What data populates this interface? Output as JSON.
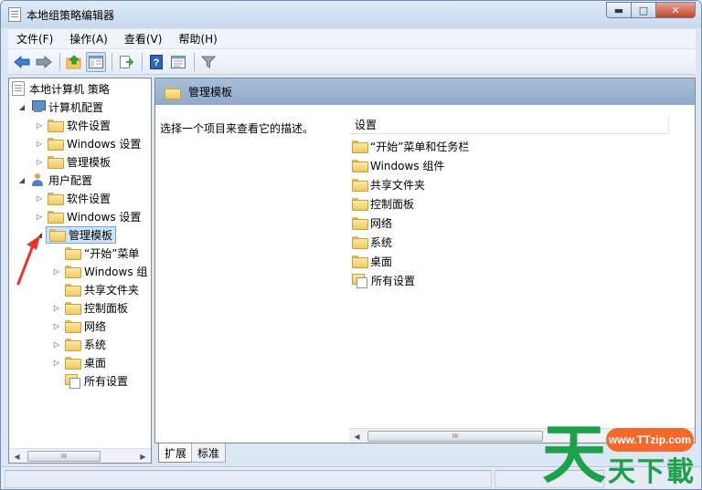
{
  "window": {
    "title": "本地组策略编辑器",
    "controls": {
      "minimize": "▬",
      "maximize": "□",
      "close": "✕"
    }
  },
  "menu": [
    {
      "label": "文件(F)"
    },
    {
      "label": "操作(A)"
    },
    {
      "label": "查看(V)"
    },
    {
      "label": "帮助(H)"
    }
  ],
  "toolbar": {
    "icons": [
      "back-arrow-icon",
      "forward-arrow-icon",
      "up-folder-icon",
      "show-hide-tree-icon",
      "export-list-icon",
      "help-icon",
      "properties-icon",
      "filter-icon"
    ],
    "help_glyph": "?"
  },
  "tree": {
    "root": "本地计算机 策略",
    "computer_config": {
      "label": "计算机配置",
      "children": [
        "软件设置",
        "Windows 设置",
        "管理模板"
      ]
    },
    "user_config": {
      "label": "用户配置",
      "children": [
        "软件设置",
        "Windows 设置"
      ],
      "selected": "管理模板",
      "selected_children": [
        "“开始”菜单",
        "Windows 组",
        "共享文件夹",
        "控制面板",
        "网络",
        "系统",
        "桌面",
        "所有设置"
      ]
    },
    "scroll_thumb": "III"
  },
  "details": {
    "header_title": "管理模板",
    "description": "选择一个项目来查看它的描述。",
    "column_header": "设置",
    "items": [
      "“开始”菜单和任务栏",
      "Windows 组件",
      "共享文件夹",
      "控制面板",
      "网络",
      "系统",
      "桌面",
      "所有设置"
    ],
    "scroll_thumb": "III"
  },
  "tabs": [
    {
      "label": "扩展"
    },
    {
      "label": "标准"
    }
  ],
  "scroll_arrows": {
    "left": "◀",
    "right": "▶"
  },
  "tree_triangles": {
    "expanded": "◢",
    "collapsed": "▷"
  },
  "annotation": {
    "color": "#e8352b"
  },
  "watermark": {
    "url": "www.TTzip.com",
    "big_char": "天",
    "small_text": "天下載",
    "color": "#1da04a",
    "pill_color": "#f26a2b"
  }
}
